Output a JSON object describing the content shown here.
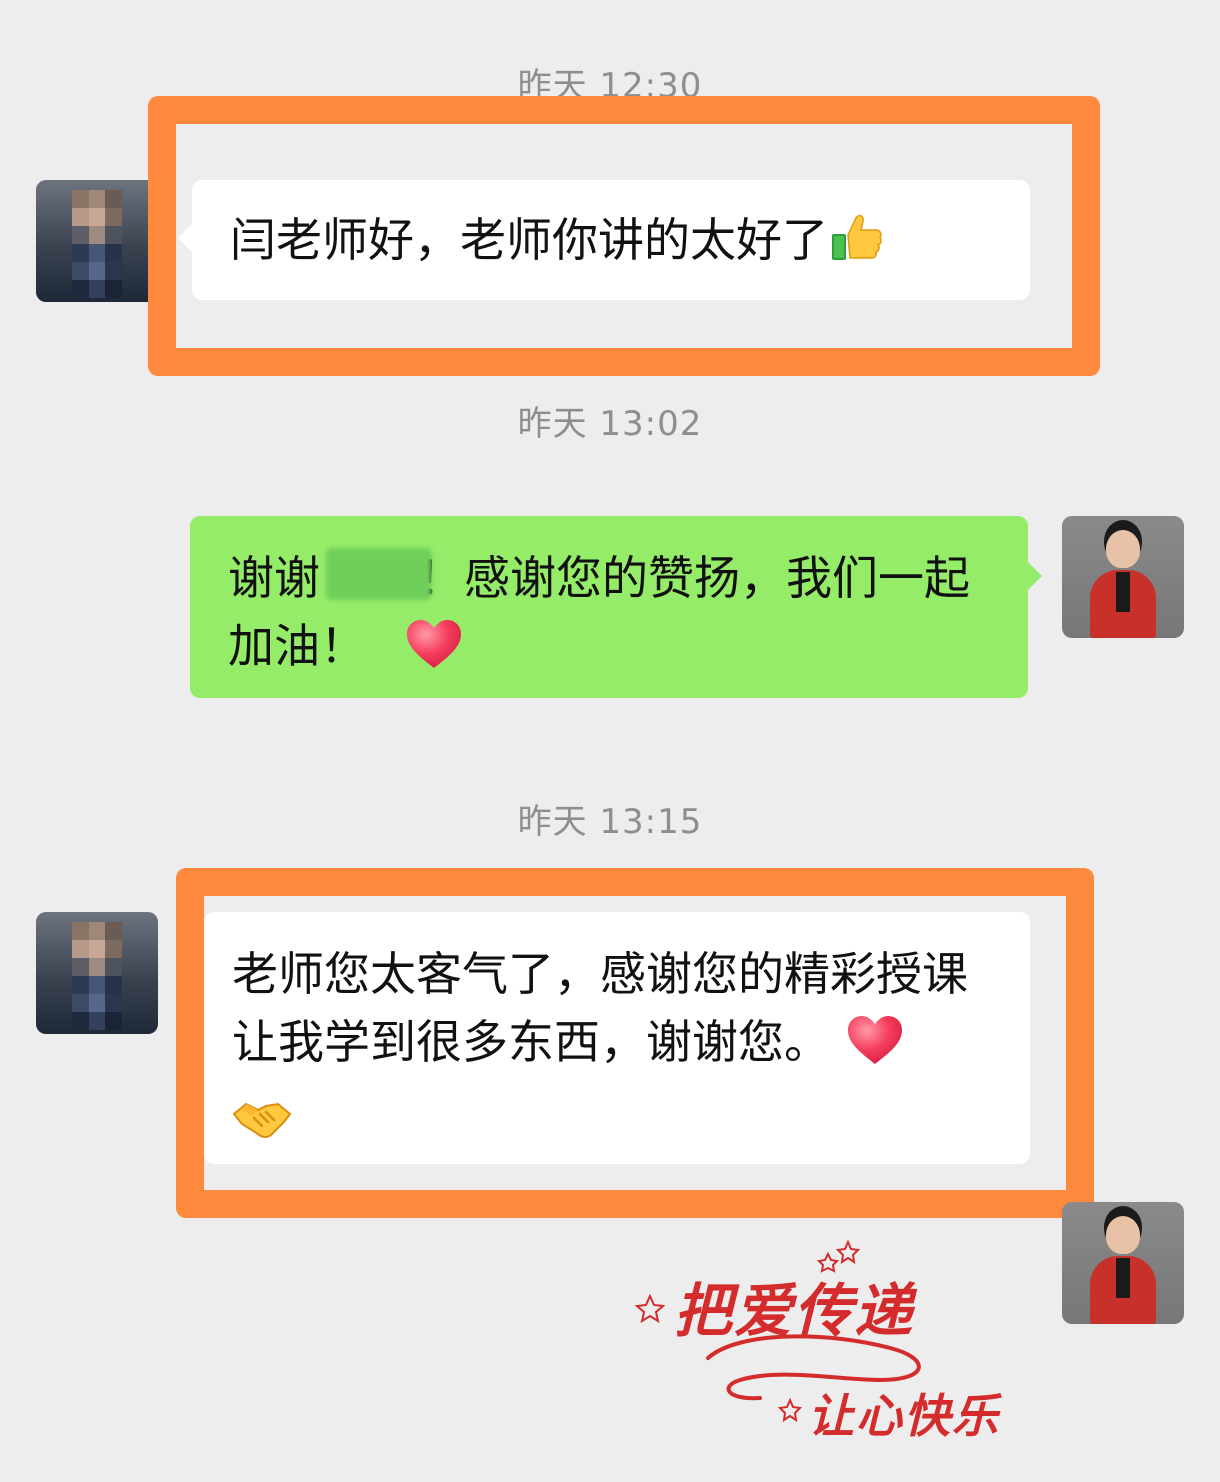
{
  "messages": [
    {
      "time": "昨天 12:30",
      "sender": "peer",
      "text": "闫老师好，老师你讲的太好了",
      "emojis": [
        "thumbs-up"
      ]
    },
    {
      "time": "昨天 13:02",
      "sender": "self",
      "text_before_redaction": "谢谢",
      "text_after_redaction": "！感谢您的赞扬，我们一起加油！",
      "emojis": [
        "heart"
      ]
    },
    {
      "time": "昨天 13:15",
      "sender": "peer",
      "text": "老师您太客气了，感谢您的精彩授课让我学到很多东西，谢谢您。",
      "emojis": [
        "heart",
        "handshake"
      ]
    },
    {
      "sender": "self",
      "sticker": {
        "line1": "把爱传递",
        "line2": "让心快乐"
      }
    }
  ],
  "colors": {
    "background": "#ededed",
    "peer_bubble": "#ffffff",
    "self_bubble": "#95ec69",
    "highlight_frame": "#ff8a3d",
    "timestamp": "#8e8e8e",
    "sticker_red": "#d42c2c"
  },
  "icons": {
    "thumbs_up": "thumbs-up-icon",
    "heart": "heart-icon",
    "handshake": "handshake-icon",
    "star": "star-icon"
  }
}
